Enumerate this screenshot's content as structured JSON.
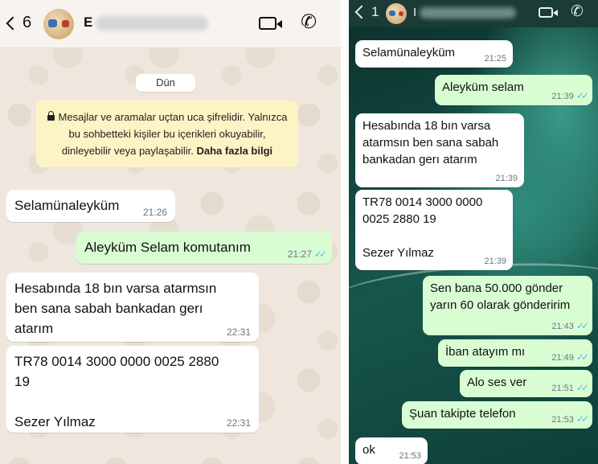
{
  "left": {
    "header": {
      "back_count": "6",
      "contact_initial": "E"
    },
    "date_chip": "Dün",
    "encryption_notice": {
      "text": "Mesajlar ve aramalar uçtan uca şifrelidir. Yalnızca bu sohbetteki kişiler bu içerikleri okuyabilir, dinleyebilir veya paylaşabilir.",
      "link": "Daha fazla bilgi"
    },
    "messages": [
      {
        "dir": "in",
        "text": "Selamünaleyküm",
        "time": "21:26"
      },
      {
        "dir": "out",
        "text": "Aleyküm Selam komutanım",
        "time": "21:27",
        "read": true
      },
      {
        "dir": "in",
        "text": "Hesabında 18 bın varsa atarmsın\nben sana sabah bankadan gerı\natarım",
        "time": "22:31"
      },
      {
        "dir": "in",
        "text": "TR78 0014 3000 0000 0025 2880\n19\n\nSezer Yılmaz",
        "time": "22:31"
      }
    ]
  },
  "right": {
    "header": {
      "back_count": "1",
      "contact_initial": "I"
    },
    "messages": [
      {
        "dir": "in",
        "text": "Selamünaleyküm",
        "time": "21:25"
      },
      {
        "dir": "out",
        "text": "Aleyküm selam",
        "time": "21:39",
        "read": true
      },
      {
        "dir": "in",
        "text": "Hesabında 18 bın varsa\natarmsın ben sana sabah\nbankadan gerı atarım",
        "time": "21:39"
      },
      {
        "dir": "in",
        "text": "TR78 0014 3000 0000\n0025 2880 19\n\nSezer Yılmaz",
        "time": "21:39"
      },
      {
        "dir": "out",
        "text": "Sen bana 50.000 gönder\nyarın 60 olarak gönderirim",
        "time": "21:43",
        "read": true
      },
      {
        "dir": "out",
        "text": "İban atayım mı",
        "time": "21:49",
        "read": true
      },
      {
        "dir": "out",
        "text": "Alo ses ver",
        "time": "21:51",
        "read": true
      },
      {
        "dir": "out",
        "text": "Şuan takipte telefon",
        "time": "21:53",
        "read": true
      },
      {
        "dir": "in",
        "text": "ok",
        "time": "21:53"
      }
    ]
  },
  "colors": {
    "incoming": "#ffffff",
    "outgoing": "#d9fdd3",
    "read_ticks": "#53bdeb",
    "notice_bg": "#fdf4c5"
  },
  "icons": [
    "back-chevron-icon",
    "video-call-icon",
    "phone-call-icon",
    "lock-icon",
    "double-check-icon"
  ]
}
